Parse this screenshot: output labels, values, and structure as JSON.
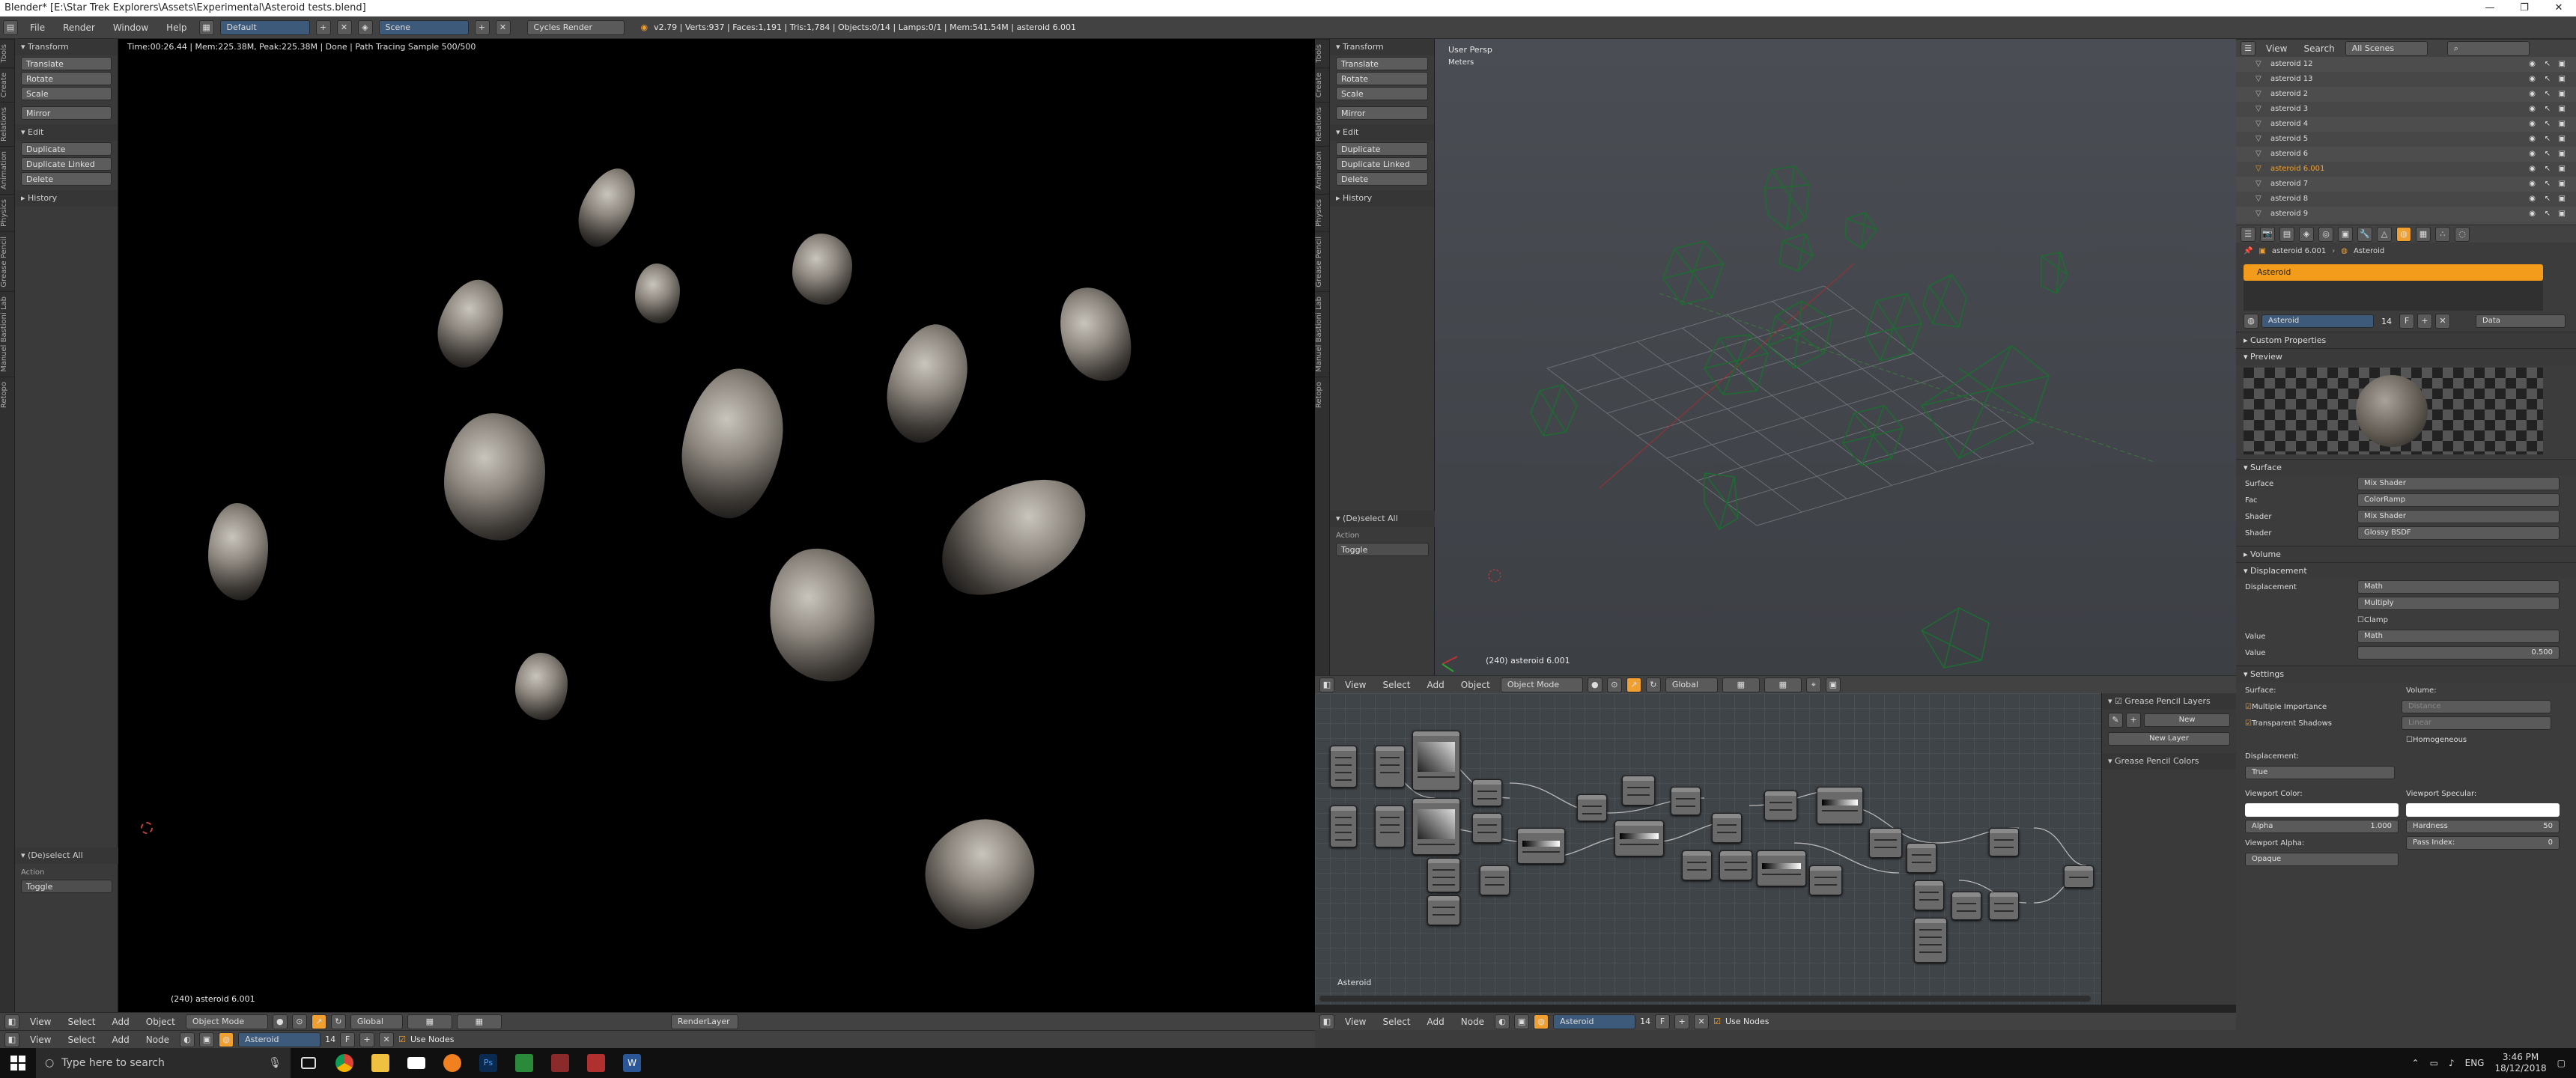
{
  "window": {
    "title": "Blender* [E:\\Star Trek Explorers\\Assets\\Experimental\\Asteroid tests.blend]",
    "controls": [
      "—",
      "❐",
      "✕"
    ]
  },
  "topbar": {
    "menus": [
      "File",
      "Render",
      "Window",
      "Help"
    ],
    "layout": "Default",
    "scene": "Scene",
    "engine": "Cycles Render",
    "stats": "v2.79 | Verts:937 | Faces:1,191 | Tris:1,784 | Objects:0/14 | Lamps:0/1 | Mem:541.54M | asteroid 6.001"
  },
  "left_view": {
    "render_info": "Time:00:26.44 | Mem:225.38M, Peak:225.38M | Done | Path Tracing Sample 500/500",
    "object_label": "(240) asteroid 6.001",
    "tabs": [
      "Tools",
      "Create",
      "Relations",
      "Animation",
      "Physics",
      "Grease Pencil",
      "Manuel Bastioni Lab",
      "Retopo",
      "Retopo"
    ]
  },
  "toolshelf": {
    "transform_title": "Transform",
    "transform_items": [
      "Translate",
      "Rotate",
      "Scale"
    ],
    "mirror": "Mirror",
    "edit_title": "Edit",
    "edit_items": [
      "Duplicate",
      "Duplicate Linked",
      "Delete"
    ],
    "history_title": "History",
    "deselect_title": "(De)select All",
    "action_label": "Action",
    "action_value": "Toggle"
  },
  "left_header": {
    "menus": [
      "View",
      "Select",
      "Add",
      "Object"
    ],
    "mode": "Object Mode",
    "orientation": "Global",
    "render_layer": "RenderLayer"
  },
  "left_node_header": {
    "menus": [
      "View",
      "Select",
      "Add",
      "Node"
    ],
    "material": "Asteroid",
    "users": "14",
    "use_nodes": "Use Nodes"
  },
  "viewport3d": {
    "view_name": "User Persp",
    "units": "Meters",
    "object_label": "(240) asteroid 6.001",
    "menus": [
      "View",
      "Select",
      "Add",
      "Object"
    ],
    "mode": "Object Mode",
    "orientation": "Global"
  },
  "node_editor": {
    "material_label": "Asteroid",
    "gp_title": "Grease Pencil Layers",
    "new_btn": "New",
    "new_layer": "New Layer",
    "gp_colors": "Grease Pencil Colors",
    "menus": [
      "View",
      "Select",
      "Add",
      "Node"
    ],
    "material": "Asteroid",
    "users": "14",
    "use_nodes": "Use Nodes"
  },
  "outliner": {
    "view": "View",
    "search": "Search",
    "scope": "All Scenes",
    "rows": [
      {
        "name": "asteroid 12",
        "sel": false
      },
      {
        "name": "asteroid 13",
        "sel": false
      },
      {
        "name": "asteroid 2",
        "sel": false
      },
      {
        "name": "asteroid 3",
        "sel": false
      },
      {
        "name": "asteroid 4",
        "sel": false
      },
      {
        "name": "asteroid 5",
        "sel": false
      },
      {
        "name": "asteroid 6",
        "sel": false
      },
      {
        "name": "asteroid 6.001",
        "sel": true
      },
      {
        "name": "asteroid 7",
        "sel": false
      },
      {
        "name": "asteroid 8",
        "sel": false
      },
      {
        "name": "asteroid 9",
        "sel": false
      }
    ]
  },
  "properties": {
    "breadcrumb_object": "asteroid 6.001",
    "breadcrumb_material": "Asteroid",
    "slot": "Asteroid",
    "mat_name": "Asteroid",
    "mat_users": "14",
    "data": "Data",
    "custom_props": "Custom Properties",
    "preview": "Preview",
    "surface_title": "Surface",
    "surface_rows": [
      {
        "label": "Surface",
        "value": "Mix Shader"
      },
      {
        "label": "Fac",
        "value": "ColorRamp"
      },
      {
        "label": "Shader",
        "value": "Mix Shader"
      },
      {
        "label": "Shader",
        "value": "Glossy BSDF"
      }
    ],
    "volume_title": "Volume",
    "displacement_title": "Displacement",
    "displacement_label": "Displacement",
    "displacement_value": "Math",
    "multiply": "Multiply",
    "clamp": "Clamp",
    "value_label": "Value",
    "value_value": "Math",
    "value2_label": "Value",
    "value2_value": "0.500",
    "settings_title": "Settings",
    "surface_label": "Surface:",
    "volume_label": "Volume:",
    "multiple_importance": "Multiple Importance",
    "transparent_shadows": "Transparent Shadows",
    "distance": "Distance",
    "linear": "Linear",
    "homogeneous": "Homogeneous",
    "displacement_sub": "Displacement:",
    "true_value": "True",
    "viewport_color": "Viewport Color:",
    "viewport_specular": "Viewport Specular:",
    "alpha_label": "Alpha",
    "alpha_value": "1.000",
    "hardness_label": "Hardness",
    "hardness_value": "50",
    "viewport_alpha": "Viewport Alpha:",
    "pass_index": "Pass Index:",
    "pass_index_value": "0",
    "opaque": "Opaque"
  },
  "taskbar": {
    "search": "Type here to search",
    "lang": "ENG",
    "time": "3:46 PM",
    "date": "18/12/2018"
  },
  "colors": {
    "accent": "#f0a030",
    "wireframe": "#1e6b32",
    "material_bar": "#f39c1b"
  }
}
